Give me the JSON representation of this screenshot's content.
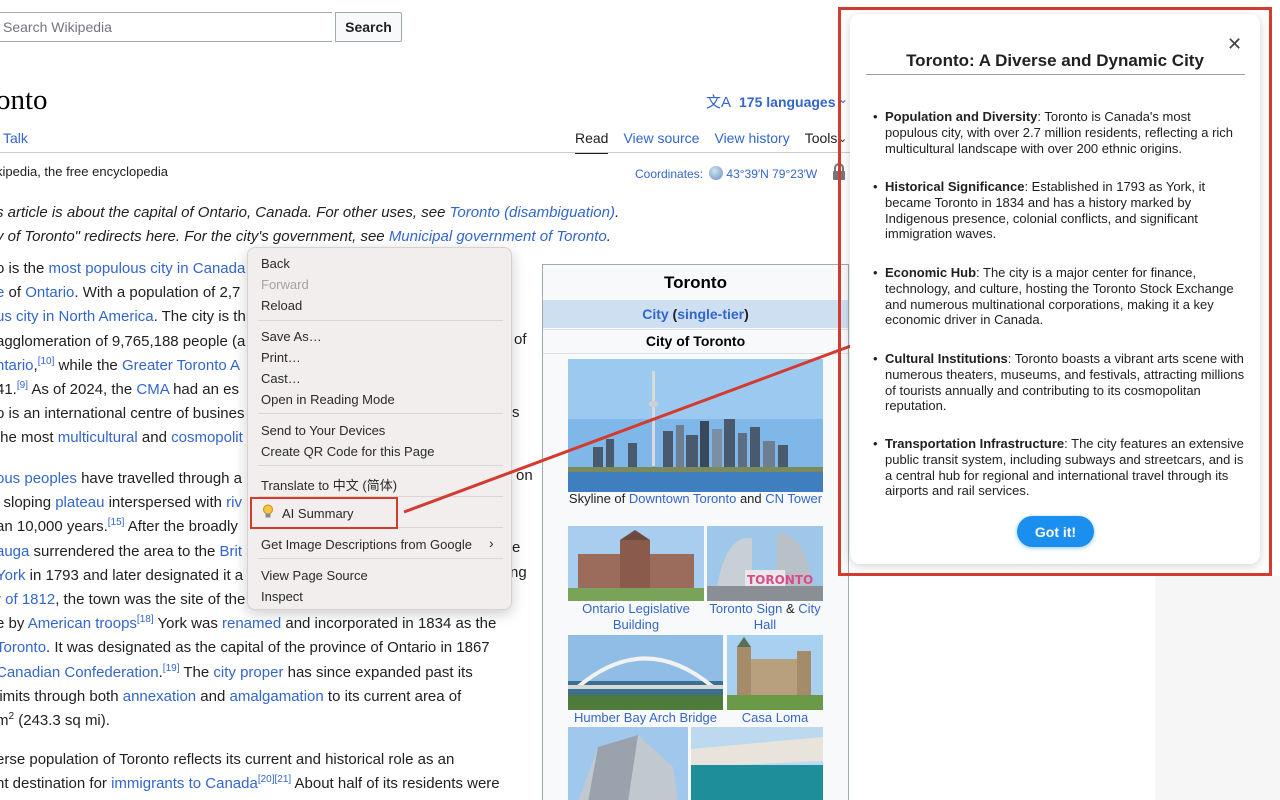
{
  "search": {
    "placeholder": "Search Wikipedia",
    "button": "Search"
  },
  "article": {
    "title": "onto",
    "languages": "175 languages",
    "tab_talk": "Talk",
    "view_tabs": [
      "Read",
      "View source",
      "View history",
      "Tools"
    ],
    "tagline": "kipedia, the free encyclopedia",
    "coordinates_label": "Coordinates:",
    "coordinates_value": "43°39′N 79°23′W",
    "hatnote1_a": "s article is about the capital of Ontario, Canada. For other uses, see ",
    "hatnote1_link": "Toronto (disambiguation)",
    "hatnote1_b": ".",
    "hatnote2_a": "y of Toronto\" redirects here. For the city's government, see ",
    "hatnote2_link": "Municipal government of Toronto",
    "hatnote2_b": "."
  },
  "infobox": {
    "title": "Toronto",
    "type_link1": "City",
    "type_link2": "single-tier",
    "subtitle": "City of Toronto",
    "caption1_a": "Skyline of ",
    "caption1_link1": "Downtown Toronto",
    "caption1_b": " and ",
    "caption1_link2": "CN Tower",
    "caption2": "Ontario Legislative Building",
    "caption3_link1": "Toronto Sign",
    "caption3_amp": " & ",
    "caption3_link2": "City Hall",
    "caption4": "Humber Bay Arch Bridge",
    "caption5": "Casa Loma"
  },
  "context_menu": {
    "back": "Back",
    "forward": "Forward",
    "reload": "Reload",
    "save_as": "Save As…",
    "print": "Print…",
    "cast": "Cast…",
    "reading_mode": "Open in Reading Mode",
    "send_devices": "Send to Your Devices",
    "qr_code": "Create QR Code for this Page",
    "translate": "Translate to 中文 (简体)",
    "ai_summary": "AI Summary",
    "image_desc": "Get Image Descriptions from Google",
    "view_source": "View Page Source",
    "inspect": "Inspect"
  },
  "popup": {
    "title": "Toronto: A Diverse and Dynamic City",
    "items": [
      {
        "heading": "Population and Diversity",
        "text": ": Toronto is Canada's most populous city, with over 2.7 million residents, reflecting a rich multicultural landscape with over 200 ethnic origins."
      },
      {
        "heading": "Historical Significance",
        "text": ": Established in 1793 as York, it became Toronto in 1834 and has a history marked by Indigenous presence, colonial conflicts, and significant immigration waves."
      },
      {
        "heading": "Economic Hub",
        "text": ": The city is a major center for finance, technology, and culture, hosting the Toronto Stock Exchange and numerous multinational corporations, making it a key economic driver in Canada."
      },
      {
        "heading": "Cultural Institutions",
        "text": ": Toronto boasts a vibrant arts scene with numerous theaters, museums, and festivals, attracting millions of tourists annually and contributing to its cosmopolitan reputation."
      },
      {
        "heading": "Transportation Infrastructure",
        "text": ": The city features an extensive public transit system, including subways and streetcars, and is a central hub for regional and international travel through its airports and rail services."
      }
    ],
    "button": "Got it!"
  },
  "body_text": {
    "p1l1_a": "o is the ",
    "p1l1_link": "most populous city in Canada",
    "p1l2_a": "e",
    "p1l2_b": " of ",
    "p1l2_link": "Ontario",
    "p1l2_c": ". With a population of 2,7",
    "p1l3_link": "us city in North America",
    "p1l3_b": ". The city is th",
    "p1l4_a": "agglomeration of 9,765,188 people (a",
    "p1l5_link1": "ntario",
    "p1l5_sup": "[10]",
    "p1l5_b": " while the ",
    "p1l5_link2": "Greater Toronto A",
    "p1l6_a": "41.",
    "p1l6_sup": "[9]",
    "p1l6_b": " As of 2024, the ",
    "p1l6_link": "CMA",
    "p1l6_c": " had an es",
    "p1l7_a": "o is an international centre of busines",
    "p1l8_a": "the most ",
    "p1l8_link1": "multicultural",
    "p1l8_b": " and ",
    "p1l8_link2": "cosmopolit",
    "p1l4_r": "of",
    "p1l7_r": "s",
    "p2l1_link": "ous peoples",
    "p2l1_b": " have travelled through a",
    "p2l1_r": "on",
    "p2l2_a": "l sloping ",
    "p2l2_link": "plateau",
    "p2l2_b": " interspersed with ",
    "p2l2_link2": "riv",
    "p2l3_a": "an 10,000 years.",
    "p2l3_sup": "[15]",
    "p2l3_b": " After the broadly",
    "p2l4_link": "auga",
    "p2l4_b": " surrendered the area to the ",
    "p2l4_link2": "Brit",
    "p2l4_r": "e",
    "p2l5_link": "York",
    "p2l5_b": " in 1793 and later designated it a",
    "p2l5_r": "ng",
    "p2l6_link": "r of 1812",
    "p2l6_b": ", the town was the site of the",
    "p2l7_a": "e by ",
    "p2l7_link": "American troops",
    "p2l7_sup": "[18]",
    "p2l7_b": " York was ",
    "p2l7_link2": "renamed",
    "p2l7_c": " and incorporated in 1834 as the",
    "p2l8_link": "Toronto",
    "p2l8_b": ". It was designated as the capital of the province of Ontario in 1867",
    "p2l9_link": "Canadian Confederation",
    "p2l9_sup": "[19]",
    "p2l9_b": " The ",
    "p2l9_link2": "city proper",
    "p2l9_c": " has since expanded past its",
    "p2l10_a": " limits through both ",
    "p2l10_link": "annexation",
    "p2l10_b": " and ",
    "p2l10_link2": "amalgamation",
    "p2l10_c": " to its current area of",
    "p2l11_a": "m",
    "p2l11_sup": "2",
    "p2l11_b": " (243.3 sq mi).",
    "p3l1_a": "erse population of Toronto reflects its current and historical role as an",
    "p3l2_a": "nt destination for ",
    "p3l2_link": "immigrants to Canada",
    "p3l2_sup": "[20][21]",
    "p3l2_b": " About half of its residents were"
  }
}
